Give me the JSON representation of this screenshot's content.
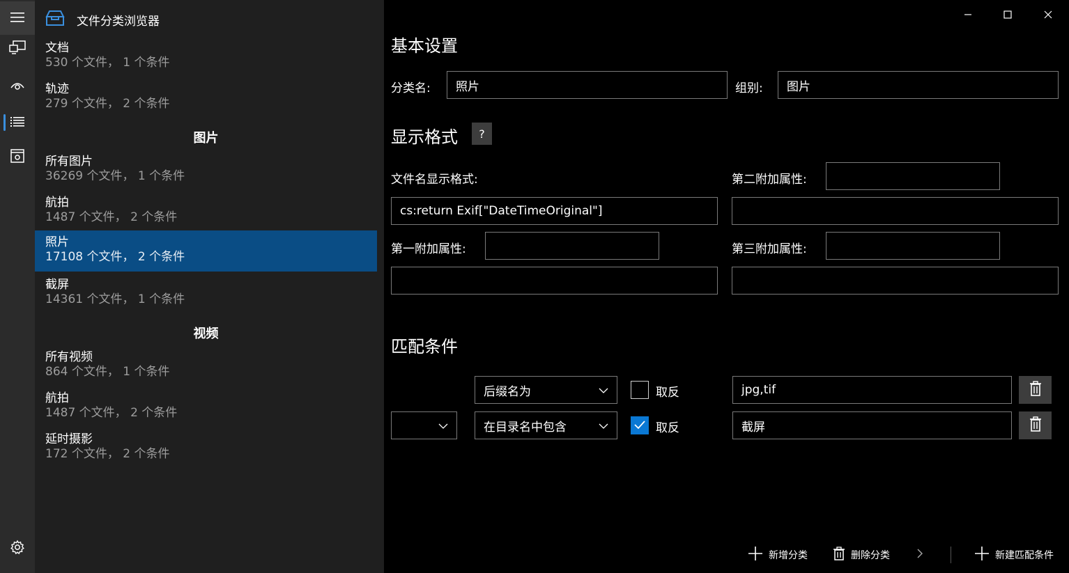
{
  "app": {
    "title": "文件分类浏览器"
  },
  "nav_rail": {
    "items": [
      "hamburger-icon",
      "devices-icon",
      "eye-icon",
      "list-icon",
      "settings-box-icon"
    ],
    "bottom": "gear-icon"
  },
  "categories": {
    "ungrouped": [
      {
        "name": "文档",
        "meta": "530 个文件， 1 个条件"
      },
      {
        "name": "轨迹",
        "meta": "279 个文件， 2 个条件"
      }
    ],
    "group_pictures": {
      "header": "图片",
      "items": [
        {
          "name": "所有图片",
          "meta": "36269 个文件， 1 个条件"
        },
        {
          "name": "航拍",
          "meta": "1487 个文件， 2 个条件"
        },
        {
          "name": "照片",
          "meta": "17108 个文件， 2 个条件"
        },
        {
          "name": "截屏",
          "meta": "14361 个文件， 1 个条件"
        }
      ]
    },
    "group_videos": {
      "header": "视频",
      "items": [
        {
          "name": "所有视频",
          "meta": "864 个文件， 1 个条件"
        },
        {
          "name": "航拍",
          "meta": "1487 个文件， 2 个条件"
        },
        {
          "name": "延时摄影",
          "meta": "172 个文件， 2 个条件"
        }
      ]
    }
  },
  "basic": {
    "heading": "基本设置",
    "name_label": "分类名:",
    "name_value": "照片",
    "group_label": "组别:",
    "group_value": "图片"
  },
  "display": {
    "heading": "显示格式",
    "help": "?",
    "filename_format_label": "文件名显示格式:",
    "filename_format_value": "cs:return Exif[\"DateTimeOriginal\"]",
    "second_attr_label": "第二附加属性:",
    "second_attr_name": "",
    "second_attr_value": "",
    "first_attr_label": "第一附加属性:",
    "first_attr_name": "",
    "first_attr_value": "",
    "third_attr_label": "第三附加属性:",
    "third_attr_name": "",
    "third_attr_value": ""
  },
  "match": {
    "heading": "匹配条件",
    "rows": [
      {
        "logic": "",
        "condition": "后缀名为",
        "negate_label": "取反",
        "negate": false,
        "value": "jpg,tif"
      },
      {
        "logic": "",
        "condition": "在目录名中包含",
        "negate_label": "取反",
        "negate": true,
        "value": "截屏"
      }
    ]
  },
  "commands": {
    "add_category": "新增分类",
    "delete_category": "删除分类",
    "new_condition": "新建匹配条件"
  },
  "colors": {
    "accent": "#0a78d4",
    "selected_item": "#0a4d85",
    "rail_bg": "#2b2b2b",
    "list_bg": "#1f1f1f"
  }
}
